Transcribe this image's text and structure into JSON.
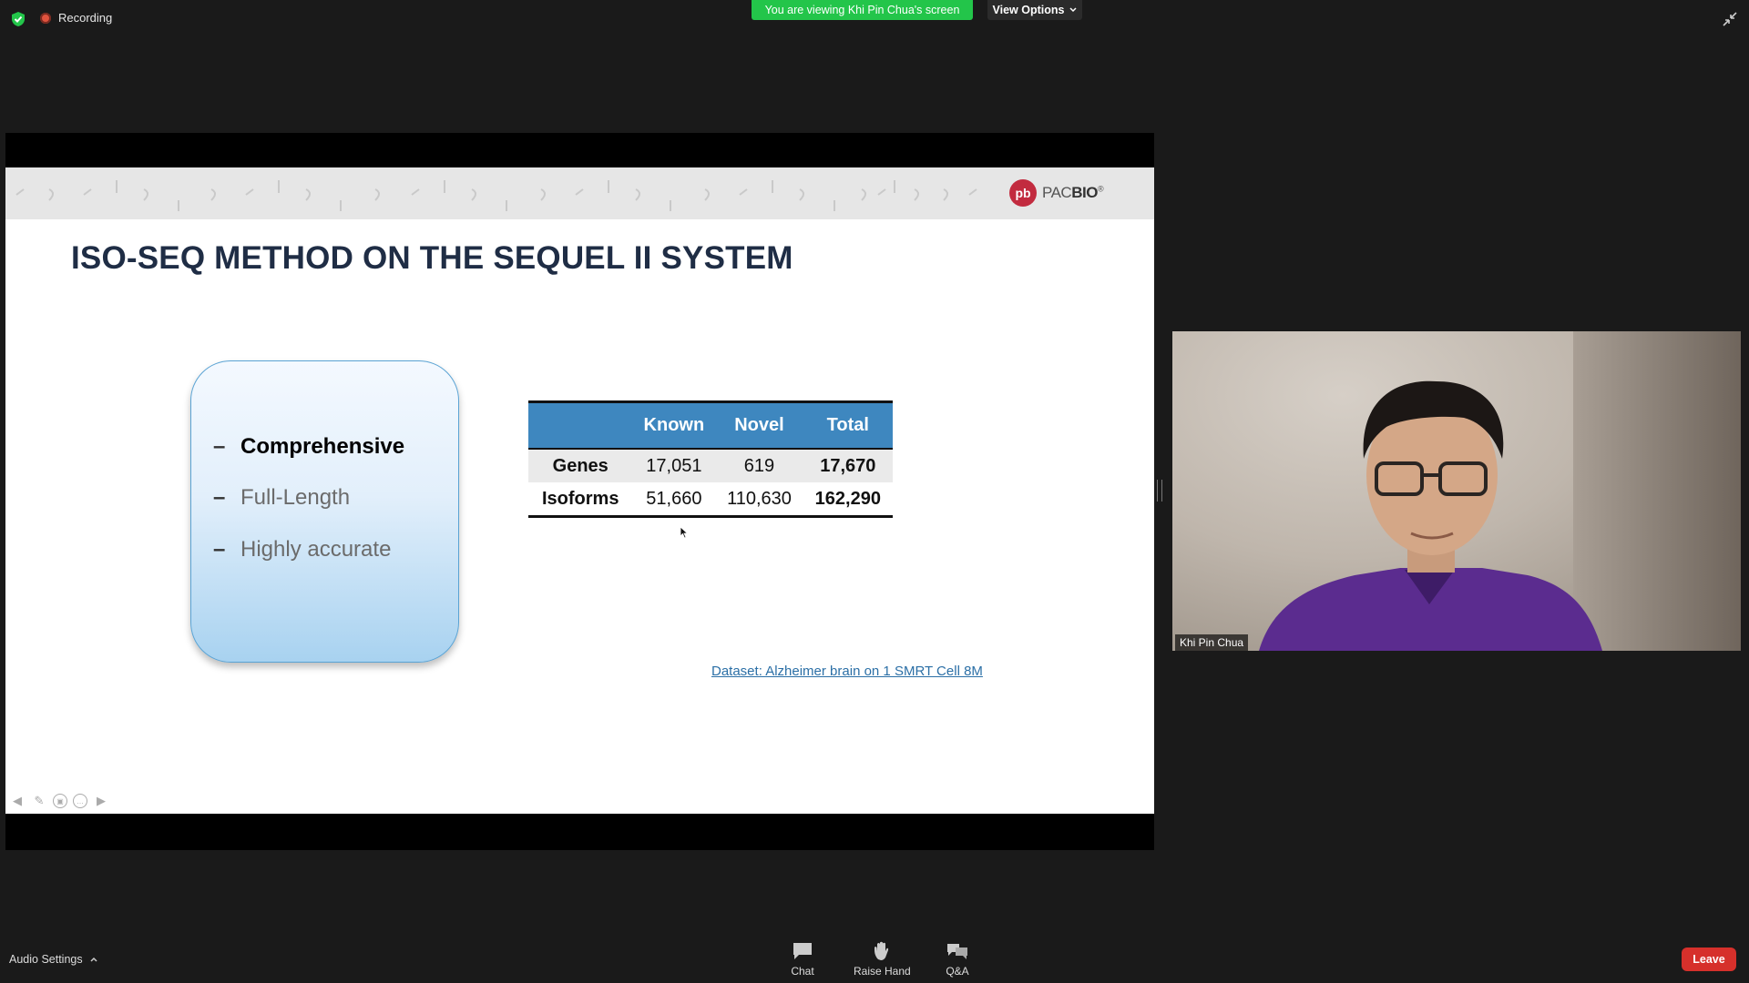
{
  "topbar": {
    "recording_label": "Recording",
    "viewing_banner": "You are viewing Khi Pin Chua's screen",
    "view_options_label": "View Options"
  },
  "slide": {
    "title": "ISO-SEQ METHOD ON THE SEQUEL II SYSTEM",
    "logo_mark": "pb",
    "logo_text_light": "PAC",
    "logo_text_bold": "BIO",
    "logo_reg": "®",
    "bullets": [
      {
        "dash": "–",
        "text": "Comprehensive"
      },
      {
        "dash": "–",
        "text": "Full-Length"
      },
      {
        "dash": "–",
        "text": "Highly accurate"
      }
    ],
    "table": {
      "columns": [
        "",
        "Known",
        "Novel",
        "Total"
      ],
      "rows": [
        {
          "label": "Genes",
          "known": "17,051",
          "novel": "619",
          "total": "17,670"
        },
        {
          "label": "Isoforms",
          "known": "51,660",
          "novel": "110,630",
          "total": "162,290"
        }
      ]
    },
    "dataset_link": "Dataset: Alzheimer brain on 1 SMRT Cell 8M"
  },
  "video": {
    "participant_name": "Khi Pin Chua"
  },
  "bottombar": {
    "audio_settings_label": "Audio Settings",
    "chat_label": "Chat",
    "raise_hand_label": "Raise Hand",
    "qa_label": "Q&A",
    "leave_label": "Leave"
  },
  "colors": {
    "viewing_banner_bg": "#23c54a",
    "leave_bg": "#d6302b",
    "table_header_bg": "#3e87bf",
    "title_color": "#1f2d45",
    "brand_red": "#c22b3f"
  }
}
